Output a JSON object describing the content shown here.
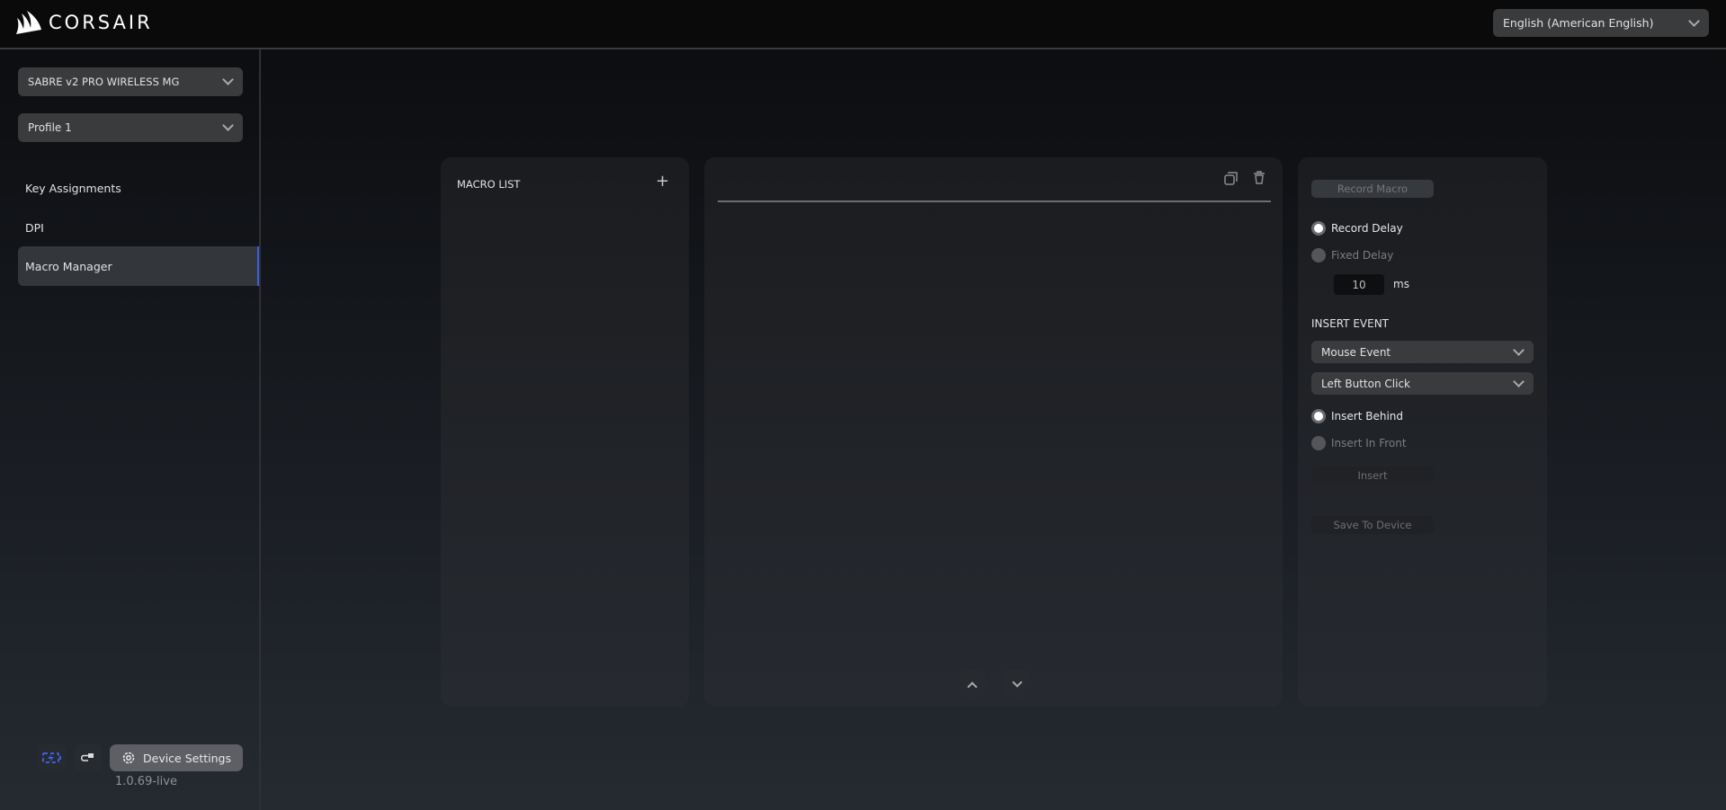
{
  "header": {
    "brand": "CORSAIR",
    "language": "English (American English)"
  },
  "sidebar": {
    "device": "SABRE v2 PRO WIRELESS MG",
    "profile": "Profile 1",
    "items": [
      {
        "label": "Key Assignments"
      },
      {
        "label": "DPI"
      },
      {
        "label": "Macro Manager",
        "active": true
      }
    ],
    "device_settings": "Device Settings",
    "version": "1.0.69-live"
  },
  "macro_list": {
    "title": "MACRO LIST"
  },
  "controls": {
    "record_macro": "Record Macro",
    "record_delay": "Record Delay",
    "fixed_delay": "Fixed Delay",
    "delay_value": "10",
    "delay_unit": "ms",
    "insert_event_title": "INSERT EVENT",
    "event_type": "Mouse Event",
    "event_action": "Left Button Click",
    "insert_behind": "Insert Behind",
    "insert_in_front": "Insert In Front",
    "insert": "Insert",
    "save_to_device": "Save To Device"
  },
  "colors": {
    "accent": "#3b5fe0"
  }
}
